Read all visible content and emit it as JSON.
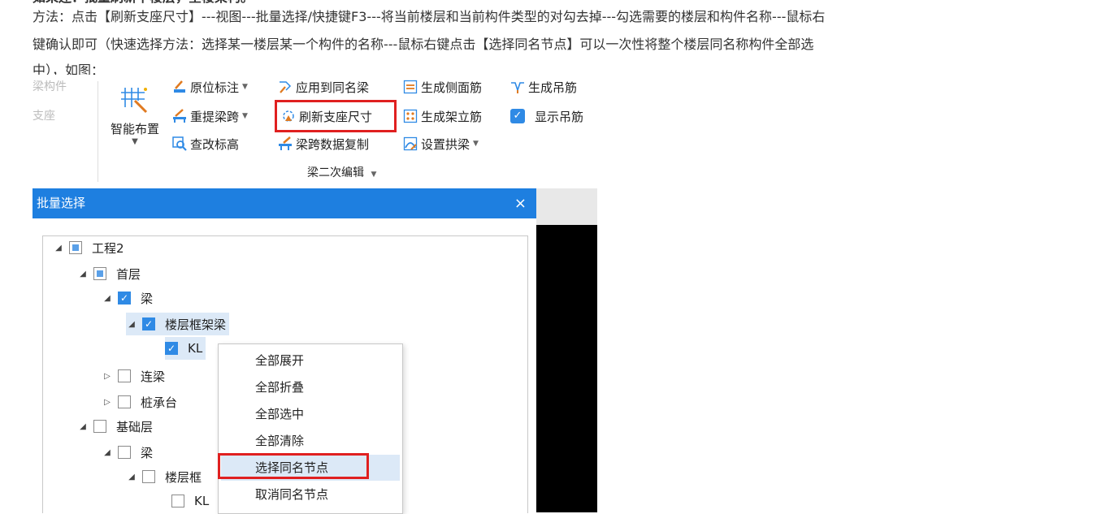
{
  "article": {
    "line0": "如果还：批量刷新下楼层，全楼架构。",
    "line1": "方法：点击【刷新支座尺寸】---视图---批量选择/快捷键F3---将当前楼层和当前构件类型的对勾去掉---勾选需要的楼层和构件名称---鼠标右",
    "line2": "键确认即可（快速选择方法：选择某一楼层某一个构件的名称---鼠标右键点击【选择同名节点】可以一次性将整个楼层同名称构件全部选",
    "line3": "中），如图："
  },
  "ribbon": {
    "faded_items": [
      "梁构件",
      "支座"
    ],
    "smart_layout": "智能布置",
    "buttons": {
      "original_mark": "原位标注",
      "apply_same": "应用到同名梁",
      "side_rebar": "生成侧面筋",
      "hanger_rebar": "生成吊筋",
      "re_span": "重提梁跨",
      "refresh_support": "刷新支座尺寸",
      "erect_rebar": "生成架立筋",
      "show_hanger": "显示吊筋",
      "edit_elev": "查改标高",
      "copy_span": "梁跨数据复制",
      "set_arch": "设置拱梁"
    },
    "group_label": "梁二次编辑"
  },
  "dialog": {
    "title": "批量选择",
    "close": "×",
    "tree": [
      {
        "label": "工程2",
        "state": "partial",
        "expand": "◢"
      },
      {
        "label": "首层",
        "state": "partial",
        "expand": "◢"
      },
      {
        "label": "梁",
        "state": "checked",
        "expand": "◢"
      },
      {
        "label": "楼层框架梁",
        "state": "checked",
        "expand": "◢"
      },
      {
        "label": "KL",
        "state": "checked",
        "expand": ""
      },
      {
        "label": "连梁",
        "state": "empty",
        "expand": "▷"
      },
      {
        "label": "桩承台",
        "state": "empty",
        "expand": "▷"
      },
      {
        "label": "基础层",
        "state": "empty",
        "expand": "◢"
      },
      {
        "label": "梁",
        "state": "empty",
        "expand": "◢"
      },
      {
        "label": "楼层框",
        "state": "empty",
        "expand": "◢"
      },
      {
        "label": "KL",
        "state": "empty",
        "expand": ""
      }
    ]
  },
  "context_menu": {
    "items": [
      "全部展开",
      "全部折叠",
      "全部选中",
      "全部清除",
      "选择同名节点",
      "取消同名节点"
    ]
  },
  "colors": {
    "accent": "#1e7fe0",
    "checkbox": "#2f8ae5",
    "highlight_box": "#e02020",
    "selection": "#dce9f7"
  }
}
